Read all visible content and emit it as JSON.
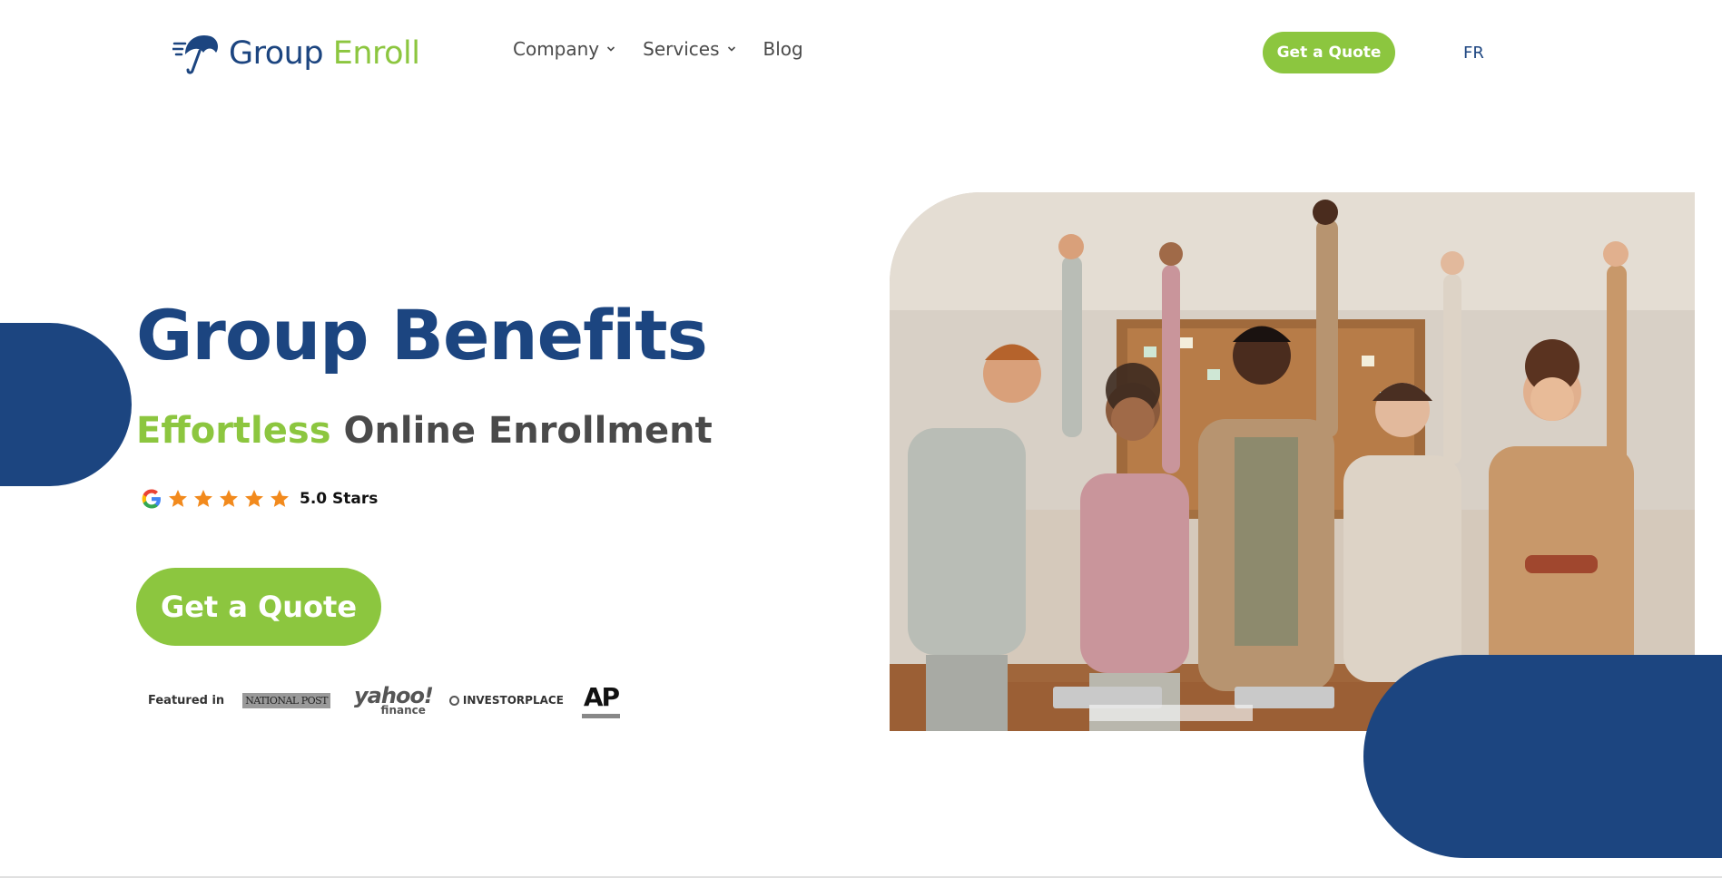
{
  "header": {
    "logo": {
      "word1": "Group",
      "word2": "Enroll",
      "icon": "umbrella-logo-icon"
    },
    "nav": [
      {
        "label": "Company",
        "has_dropdown": true
      },
      {
        "label": "Services",
        "has_dropdown": true
      },
      {
        "label": "Blog",
        "has_dropdown": false
      }
    ],
    "cta_label": "Get a Quote",
    "lang_label": "FR"
  },
  "hero": {
    "title": "Group Benefits",
    "subtitle_green": "Effortless",
    "subtitle_rest": "Online Enrollment",
    "rating": {
      "stars": 5,
      "text": "5.0 Stars",
      "icon": "google-icon"
    },
    "cta_label": "Get a Quote"
  },
  "featured": {
    "label": "Featured in",
    "outlets": [
      {
        "name": "NATIONAL POST"
      },
      {
        "name": "yahoo!",
        "sub": "finance"
      },
      {
        "name": "INVESTORPLACE"
      },
      {
        "name": "AP"
      }
    ]
  },
  "colors": {
    "brand_blue": "#1c4580",
    "brand_green": "#8cc63f",
    "text_grey": "#4a4a4a",
    "star_orange": "#f28a1d"
  }
}
